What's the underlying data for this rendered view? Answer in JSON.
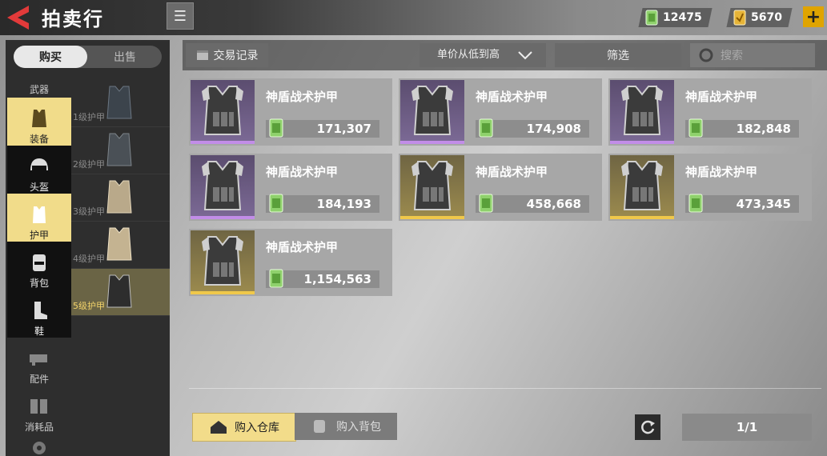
{
  "header": {
    "title": "拍卖行",
    "currency_cash": "12475",
    "currency_gold": "5670"
  },
  "left": {
    "tabs": [
      "购买",
      "出售"
    ],
    "categories": [
      {
        "label": "武器",
        "icon": "gun-icon"
      },
      {
        "label": "装备",
        "icon": "vest-icon"
      },
      {
        "label": "头盔",
        "icon": "helmet-icon"
      },
      {
        "label": "护甲",
        "icon": "armor-icon"
      },
      {
        "label": "背包",
        "icon": "backpack-icon"
      },
      {
        "label": "鞋",
        "icon": "boot-icon"
      },
      {
        "label": "配件",
        "icon": "attachment-icon"
      },
      {
        "label": "消耗品",
        "icon": "consumable-icon"
      }
    ],
    "subcategories": [
      "1级护甲",
      "2级护甲",
      "3级护甲",
      "4级护甲",
      "5级护甲"
    ]
  },
  "toolbar": {
    "history": "交易记录",
    "sort": "单价从低到高",
    "filter": "筛选",
    "search_placeholder": "搜索"
  },
  "listings": [
    {
      "name": "神盾战术护甲",
      "price": "171,307",
      "rarity": "purple"
    },
    {
      "name": "神盾战术护甲",
      "price": "174,908",
      "rarity": "purple"
    },
    {
      "name": "神盾战术护甲",
      "price": "182,848",
      "rarity": "purple"
    },
    {
      "name": "神盾战术护甲",
      "price": "184,193",
      "rarity": "purple"
    },
    {
      "name": "神盾战术护甲",
      "price": "458,668",
      "rarity": "gold"
    },
    {
      "name": "神盾战术护甲",
      "price": "473,345",
      "rarity": "gold"
    },
    {
      "name": "神盾战术护甲",
      "price": "1,154,563",
      "rarity": "gold"
    }
  ],
  "bottom": {
    "buy_warehouse": "购入仓库",
    "buy_backpack": "购入背包",
    "pagination": "1/1"
  }
}
